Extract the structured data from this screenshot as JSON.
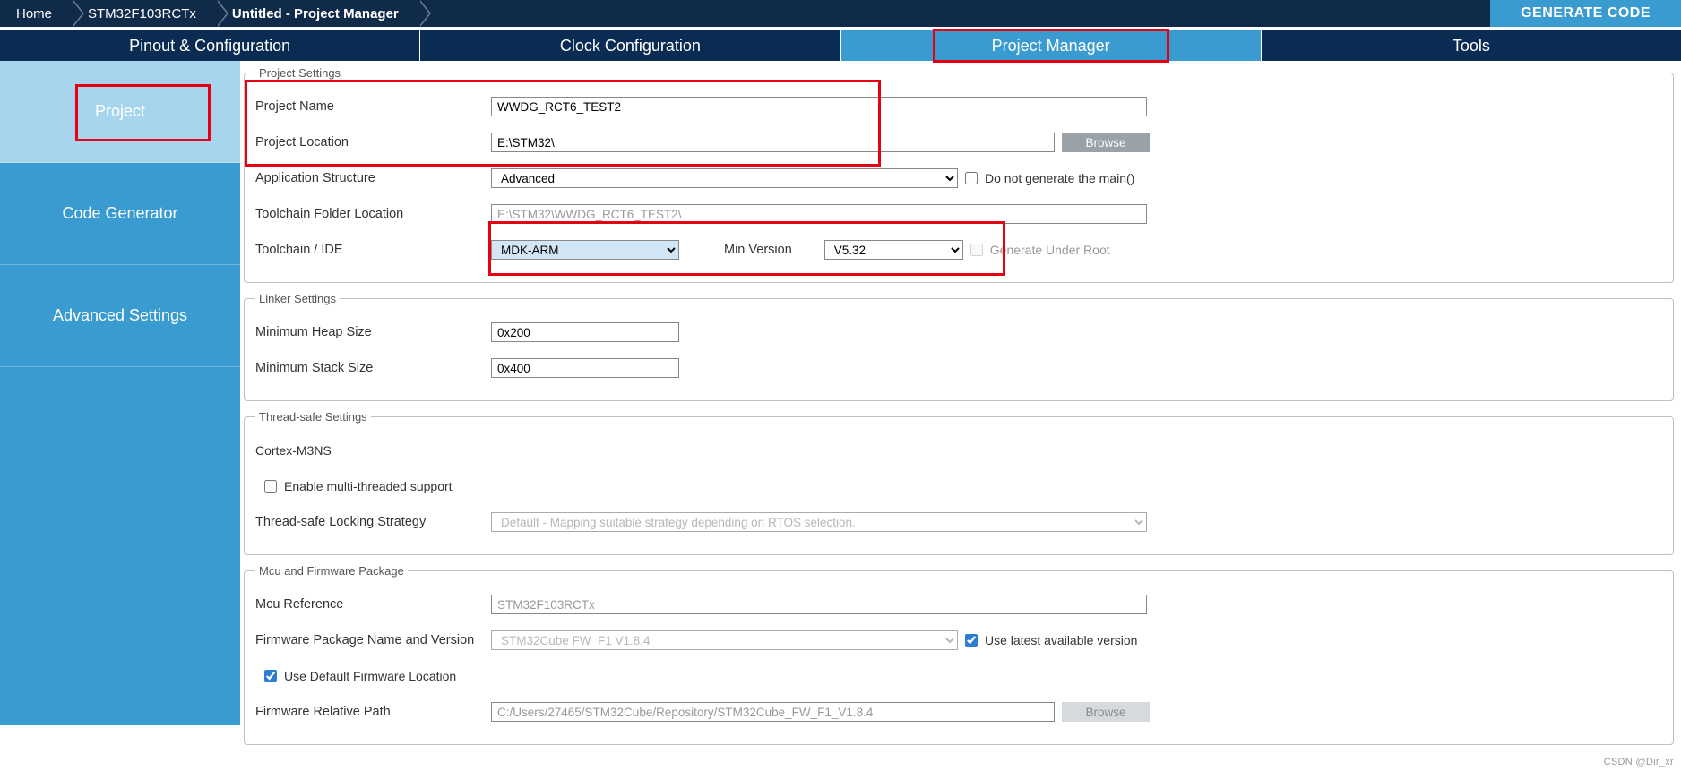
{
  "breadcrumb": {
    "home": "Home",
    "chip": "STM32F103RCTx",
    "project": "Untitled - Project Manager"
  },
  "generate_code": "GENERATE CODE",
  "tabs": {
    "pinout": "Pinout & Configuration",
    "clock": "Clock Configuration",
    "pm": "Project Manager",
    "tools": "Tools"
  },
  "sidebar": {
    "project": "Project",
    "codegen": "Code Generator",
    "advanced": "Advanced Settings"
  },
  "project_settings": {
    "legend": "Project Settings",
    "name_label": "Project Name",
    "name_value": "WWDG_RCT6_TEST2",
    "location_label": "Project Location",
    "location_value": "E:\\STM32\\",
    "browse": "Browse",
    "app_struct_label": "Application Structure",
    "app_struct_value": "Advanced",
    "no_main_label": "Do not generate the main()",
    "toolchain_folder_label": "Toolchain Folder Location",
    "toolchain_folder_value": "E:\\STM32\\WWDG_RCT6_TEST2\\",
    "toolchain_label": "Toolchain / IDE",
    "toolchain_value": "MDK-ARM",
    "min_ver_label": "Min Version",
    "min_ver_value": "V5.32",
    "gen_under_root_label": "Generate Under Root"
  },
  "linker": {
    "legend": "Linker Settings",
    "heap_label": "Minimum Heap Size",
    "heap_value": "0x200",
    "stack_label": "Minimum Stack Size",
    "stack_value": "0x400"
  },
  "thread": {
    "legend": "Thread-safe Settings",
    "core": "Cortex-M3NS",
    "enable_label": "Enable multi-threaded support",
    "strategy_label": "Thread-safe Locking Strategy",
    "strategy_value": "Default  -  Mapping suitable strategy depending on RTOS selection."
  },
  "mcu": {
    "legend": "Mcu and Firmware Package",
    "ref_label": "Mcu Reference",
    "ref_value": "STM32F103RCTx",
    "fw_label": "Firmware Package Name and Version",
    "fw_value": "STM32Cube FW_F1 V1.8.4",
    "use_latest_label": "Use latest available version",
    "use_default_label": "Use Default Firmware Location",
    "rel_path_label": "Firmware Relative Path",
    "rel_path_value": "C:/Users/27465/STM32Cube/Repository/STM32Cube_FW_F1_V1.8.4",
    "browse": "Browse"
  },
  "watermark": "CSDN @Dir_xr"
}
